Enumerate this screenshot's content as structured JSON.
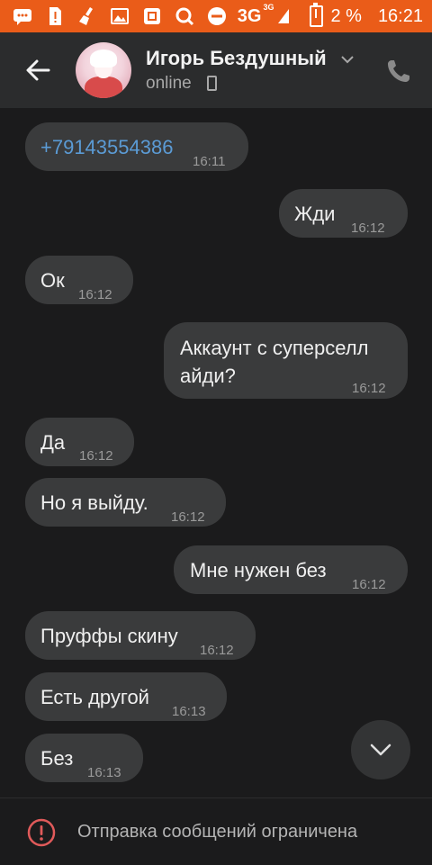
{
  "status_bar": {
    "network": "3G",
    "network_sup": "3G",
    "battery": "2 %",
    "time": "16:21",
    "color": "#ea5c19"
  },
  "header": {
    "contact_name": "Игорь Бездушный",
    "status": "online"
  },
  "messages": [
    {
      "side": "in",
      "text": "+79143554386",
      "time": "16:11"
    },
    {
      "side": "out",
      "text": "Жди",
      "time": "16:12"
    },
    {
      "side": "in",
      "text": "Ок",
      "time": "16:12"
    },
    {
      "side": "out",
      "text_line1": "Аккаунт с суперселл",
      "text_line2": "айди?",
      "time": "16:12"
    },
    {
      "side": "in",
      "text": "Да",
      "time": "16:12"
    },
    {
      "side": "in",
      "text": "Но я выйду.",
      "time": "16:12"
    },
    {
      "side": "out",
      "text": "Мне нужен без",
      "time": "16:12"
    },
    {
      "side": "in",
      "text": "Пруффы скину",
      "time": "16:12"
    },
    {
      "side": "in",
      "text": "Есть другой",
      "time": "16:13"
    },
    {
      "side": "in",
      "text": "Без",
      "time": "16:13"
    }
  ],
  "bottom_bar": {
    "text": "Отправка сообщений ограничена"
  },
  "icons": {
    "back": "arrow-left-icon",
    "call": "phone-icon",
    "scroll_down": "chevron-down-icon",
    "warning": "alert-circle-icon"
  }
}
